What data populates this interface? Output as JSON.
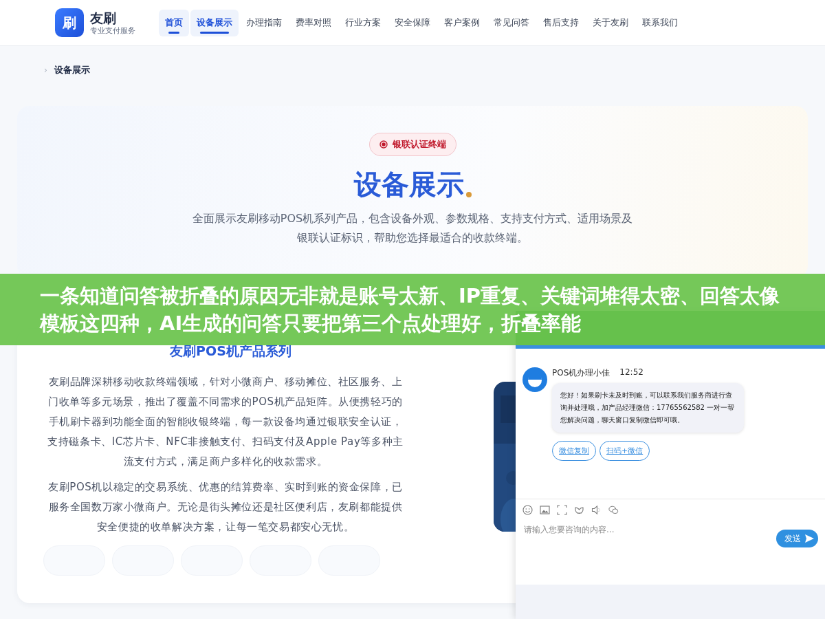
{
  "header": {
    "logo_mark": "刷",
    "brand": "友刷",
    "tagline": "专业支付服务",
    "nav": [
      {
        "label": "首页",
        "selected": true
      },
      {
        "label": "设备展示",
        "selected": true
      },
      {
        "label": "办理指南",
        "selected": false
      },
      {
        "label": "费率对照",
        "selected": false
      },
      {
        "label": "行业方案",
        "selected": false
      },
      {
        "label": "安全保障",
        "selected": false
      },
      {
        "label": "客户案例",
        "selected": false
      },
      {
        "label": "常见问答",
        "selected": false
      },
      {
        "label": "售后支持",
        "selected": false
      },
      {
        "label": "关于友刷",
        "selected": false
      },
      {
        "label": "联系我们",
        "selected": false
      }
    ]
  },
  "breadcrumb": {
    "separator": "›",
    "current": "设备展示"
  },
  "hero": {
    "badge": "银联认证终端",
    "title": "设备展示",
    "subtitle": "全面展示友刷移动POS机系列产品，包含设备外观、参数规格、支持支付方式、适用场景及银联认证标识，帮助您选择最适合的收款终端。"
  },
  "product_section": {
    "title": "友刷POS机产品系列",
    "paragraphs": [
      "友刷品牌深耕移动收款终端领域，针对小微商户、移动摊位、社区服务、上门收单等多元场景，推出了覆盖不同需求的POS机产品矩阵。从便携轻巧的手机刷卡器到功能全面的智能收银终端，每一款设备均通过银联安全认证，支持磁条卡、IC芯片卡、NFC非接触支付、扫码支付及Apple Pay等多种主流支付方式，满足商户多样化的收款需求。",
      "友刷POS机以稳定的交易系统、优惠的结算费率、实时到账的资金保障，已服务全国数万家小微商户。无论是街头摊位还是社区便利店，友刷都能提供安全便捷的收单解决方案，让每一笔交易都安心无忧。"
    ]
  },
  "chat": {
    "agent": "POS机办理小佳",
    "time": "12:52",
    "message": "您好！如果刷卡未及时到账，可以联系我们服务商进行查询并处理哦，加产品经理微信：17765562582 一对一帮您解决问题，聊天窗口复制微信即可哦。",
    "actions": [
      "微信复制",
      "扫码+微信"
    ],
    "input": {
      "placeholder": "请输入您要咨询的内容..."
    },
    "send": "发送"
  },
  "overlay_banner": {
    "text": "一条知道问答被折叠的原因无非就是账号太新、IP重复、关键词堆得太密、回答太像模板这四种，AI生成的问答只要把第三个点处理好，折叠率能"
  }
}
